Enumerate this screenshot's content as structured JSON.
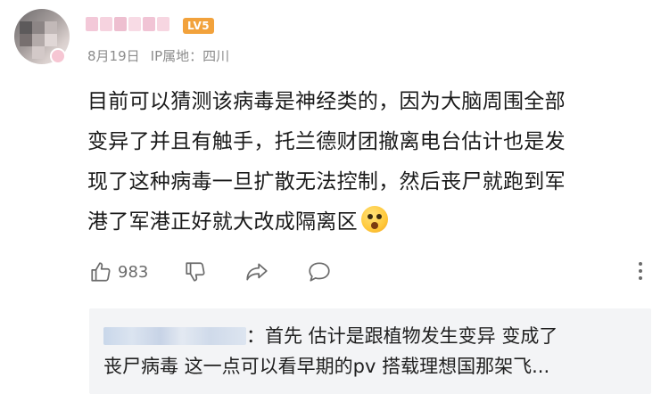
{
  "comment": {
    "user": {
      "level_badge": "LV5"
    },
    "meta": {
      "date": "8月19日",
      "ip_location": "IP属地：四川"
    },
    "text_lines": [
      "目前可以猜测该病毒是神经类的，因为大脑周围全部",
      "变异了并且有触手，托兰德财团撤离电台估计也是发",
      "现了这种病毒一旦扩散无法控制，然后丧尸就跑到军",
      "港了军港正好就大改成隔离区"
    ],
    "emoji": "astonished-face-emoji",
    "actions": {
      "like_count": "983"
    }
  },
  "reply": {
    "line1": "：首先 估计是跟植物发生变异 变成了",
    "line2": "丧尸病毒 这一点可以看早期的pv 搭载理想国那架飞..."
  },
  "colors": {
    "level_badge": "#f2a23c",
    "meta_text": "#8c8c8c",
    "reply_bg": "#f3f4f6",
    "icon": "#6b6b6b"
  }
}
